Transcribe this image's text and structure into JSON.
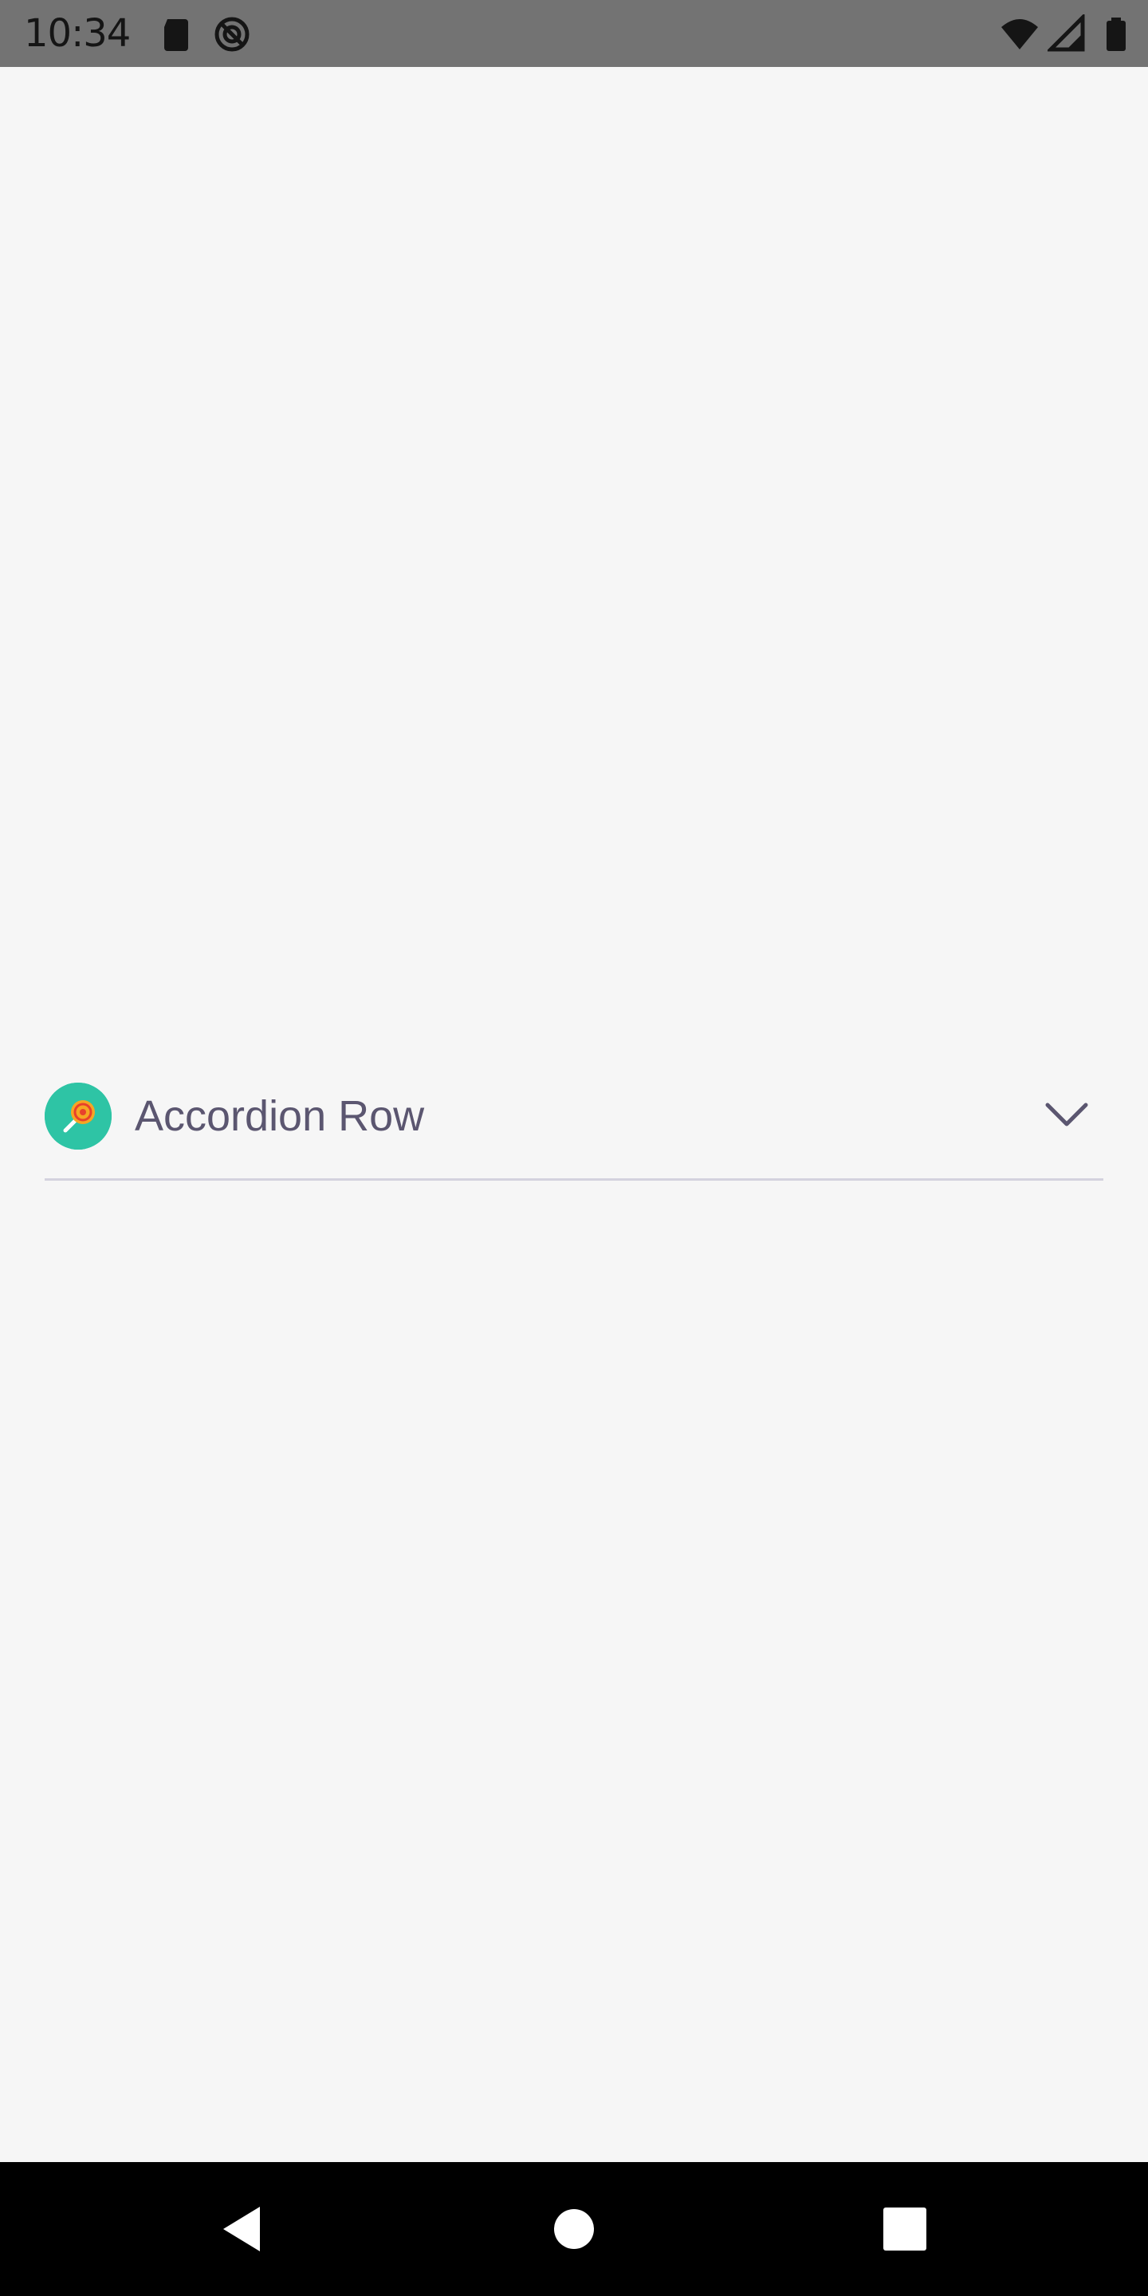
{
  "status_bar": {
    "time": "10:34",
    "icons": [
      "sd-card-icon",
      "sync-icon",
      "wifi-icon",
      "signal-icon",
      "battery-icon"
    ]
  },
  "accordion": {
    "label": "Accordion Row",
    "icon": "lollipop-icon",
    "chevron": "chevron-down-icon",
    "expanded": false,
    "accent_color": "#2ec4a5"
  },
  "nav_bar": {
    "buttons": [
      "back-icon",
      "home-icon",
      "recents-icon"
    ]
  }
}
